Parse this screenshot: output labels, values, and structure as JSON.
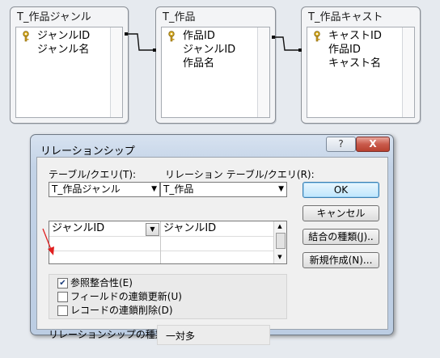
{
  "tables": [
    {
      "title": "T_作品ジャンル",
      "fields": [
        {
          "name": "ジャンルID",
          "key": true
        },
        {
          "name": "ジャンル名",
          "key": false
        }
      ]
    },
    {
      "title": "T_作品",
      "fields": [
        {
          "name": "作品ID",
          "key": true
        },
        {
          "name": "ジャンルID",
          "key": false
        },
        {
          "name": "作品名",
          "key": false
        }
      ]
    },
    {
      "title": "T_作品キャスト",
      "fields": [
        {
          "name": "キャストID",
          "key": true
        },
        {
          "name": "作品ID",
          "key": false
        },
        {
          "name": "キャスト名",
          "key": false
        }
      ]
    }
  ],
  "dialog": {
    "title": "リレーションシップ",
    "help_label": "?",
    "close_label": "X",
    "table_query_label": "テーブル/クエリ(T):",
    "related_table_query_label": "リレーション テーブル/クエリ(R):",
    "table_value": "T_作品ジャンル",
    "related_table_value": "T_作品",
    "grid_rows": [
      {
        "left": "ジャンルID",
        "right": "ジャンルID"
      }
    ],
    "buttons": {
      "ok": "OK",
      "cancel": "キャンセル",
      "join_type": "結合の種類(J)..",
      "create_new": "新規作成(N)..."
    },
    "options": [
      {
        "label": "参照整合性(E)",
        "checked": true
      },
      {
        "label": "フィールドの連鎖更新(U)",
        "checked": false
      },
      {
        "label": "レコードの連鎖削除(D)",
        "checked": false
      }
    ],
    "relationship_type_label": "リレーションシップの種類：",
    "relationship_type_value": "一対多"
  },
  "annotation_arrow_color": "#e02020"
}
